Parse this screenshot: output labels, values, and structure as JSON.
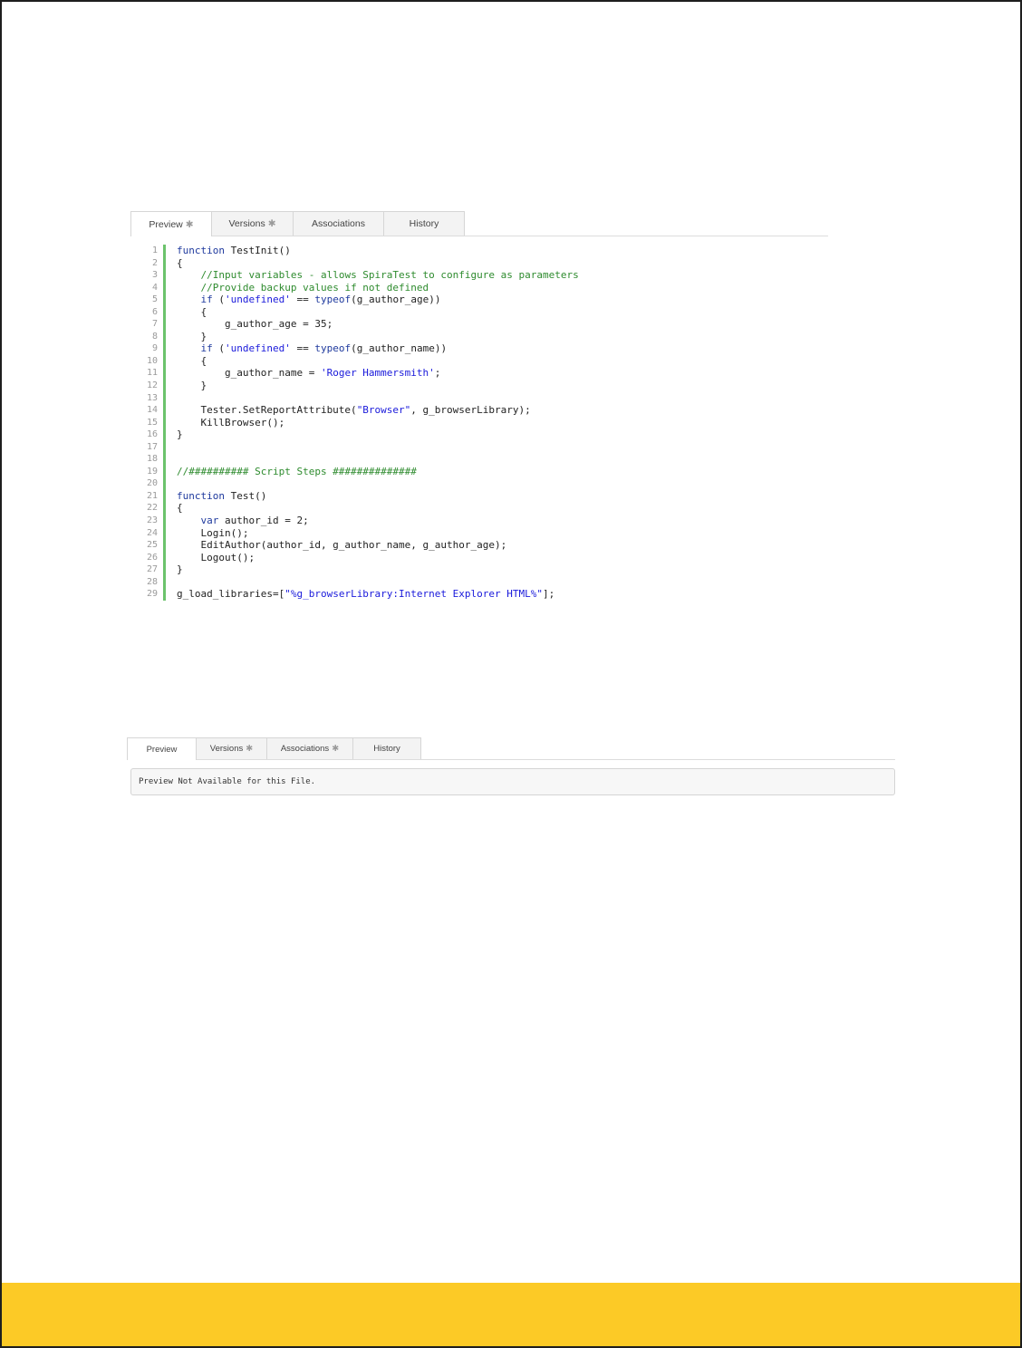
{
  "panel1": {
    "tabs": [
      {
        "label": "Preview",
        "star": true,
        "active": true
      },
      {
        "label": "Versions",
        "star": true,
        "active": false
      },
      {
        "label": "Associations",
        "star": false,
        "active": false
      },
      {
        "label": "History",
        "star": false,
        "active": false
      }
    ],
    "code_lines": [
      [
        [
          "kw",
          "function"
        ],
        [
          "t",
          " TestInit()"
        ]
      ],
      [
        [
          "t",
          "{"
        ]
      ],
      [
        [
          "t",
          "    "
        ],
        [
          "cm",
          "//Input variables - allows SpiraTest to configure as parameters"
        ]
      ],
      [
        [
          "t",
          "    "
        ],
        [
          "cm",
          "//Provide backup values if not defined"
        ]
      ],
      [
        [
          "t",
          "    "
        ],
        [
          "kw",
          "if"
        ],
        [
          "t",
          " ("
        ],
        [
          "st",
          "'undefined'"
        ],
        [
          "t",
          " == "
        ],
        [
          "kw",
          "typeof"
        ],
        [
          "t",
          "(g_author_age))"
        ]
      ],
      [
        [
          "t",
          "    {"
        ]
      ],
      [
        [
          "t",
          "        g_author_age = 35;"
        ]
      ],
      [
        [
          "t",
          "    }"
        ]
      ],
      [
        [
          "t",
          "    "
        ],
        [
          "kw",
          "if"
        ],
        [
          "t",
          " ("
        ],
        [
          "st",
          "'undefined'"
        ],
        [
          "t",
          " == "
        ],
        [
          "kw",
          "typeof"
        ],
        [
          "t",
          "(g_author_name))"
        ]
      ],
      [
        [
          "t",
          "    {"
        ]
      ],
      [
        [
          "t",
          "        g_author_name = "
        ],
        [
          "st",
          "'Roger Hammersmith'"
        ],
        [
          "t",
          ";"
        ]
      ],
      [
        [
          "t",
          "    }"
        ]
      ],
      [],
      [
        [
          "t",
          "    Tester.SetReportAttribute("
        ],
        [
          "st",
          "\"Browser\""
        ],
        [
          "t",
          ", g_browserLibrary);"
        ]
      ],
      [
        [
          "t",
          "    KillBrowser();"
        ]
      ],
      [
        [
          "t",
          "}"
        ]
      ],
      [],
      [],
      [
        [
          "cm",
          "//########## Script Steps ##############"
        ]
      ],
      [],
      [
        [
          "kw",
          "function"
        ],
        [
          "t",
          " Test()"
        ]
      ],
      [
        [
          "t",
          "{"
        ]
      ],
      [
        [
          "t",
          "    "
        ],
        [
          "kw",
          "var"
        ],
        [
          "t",
          " author_id = 2;"
        ]
      ],
      [
        [
          "t",
          "    Login();"
        ]
      ],
      [
        [
          "t",
          "    EditAuthor(author_id, g_author_name, g_author_age);"
        ]
      ],
      [
        [
          "t",
          "    Logout();"
        ]
      ],
      [
        [
          "t",
          "}"
        ]
      ],
      [],
      [
        [
          "t",
          "g_load_libraries=["
        ],
        [
          "st",
          "\"%g_browserLibrary:Internet Explorer HTML%\""
        ],
        [
          "t",
          "];"
        ]
      ]
    ]
  },
  "panel2": {
    "tabs": [
      {
        "label": "Preview",
        "star": false,
        "active": true
      },
      {
        "label": "Versions",
        "star": true,
        "active": false
      },
      {
        "label": "Associations",
        "star": true,
        "active": false
      },
      {
        "label": "History",
        "star": false,
        "active": false
      }
    ],
    "message": "Preview Not Available for this File."
  },
  "colors": {
    "footer_bar": "#fcca26",
    "gutter_bar": "#6cc36c",
    "keyword": "#1f3a9e",
    "comment": "#2e8b2e",
    "string": "#1a1adb"
  },
  "icons": {
    "tab_star": "asterisk-icon"
  }
}
